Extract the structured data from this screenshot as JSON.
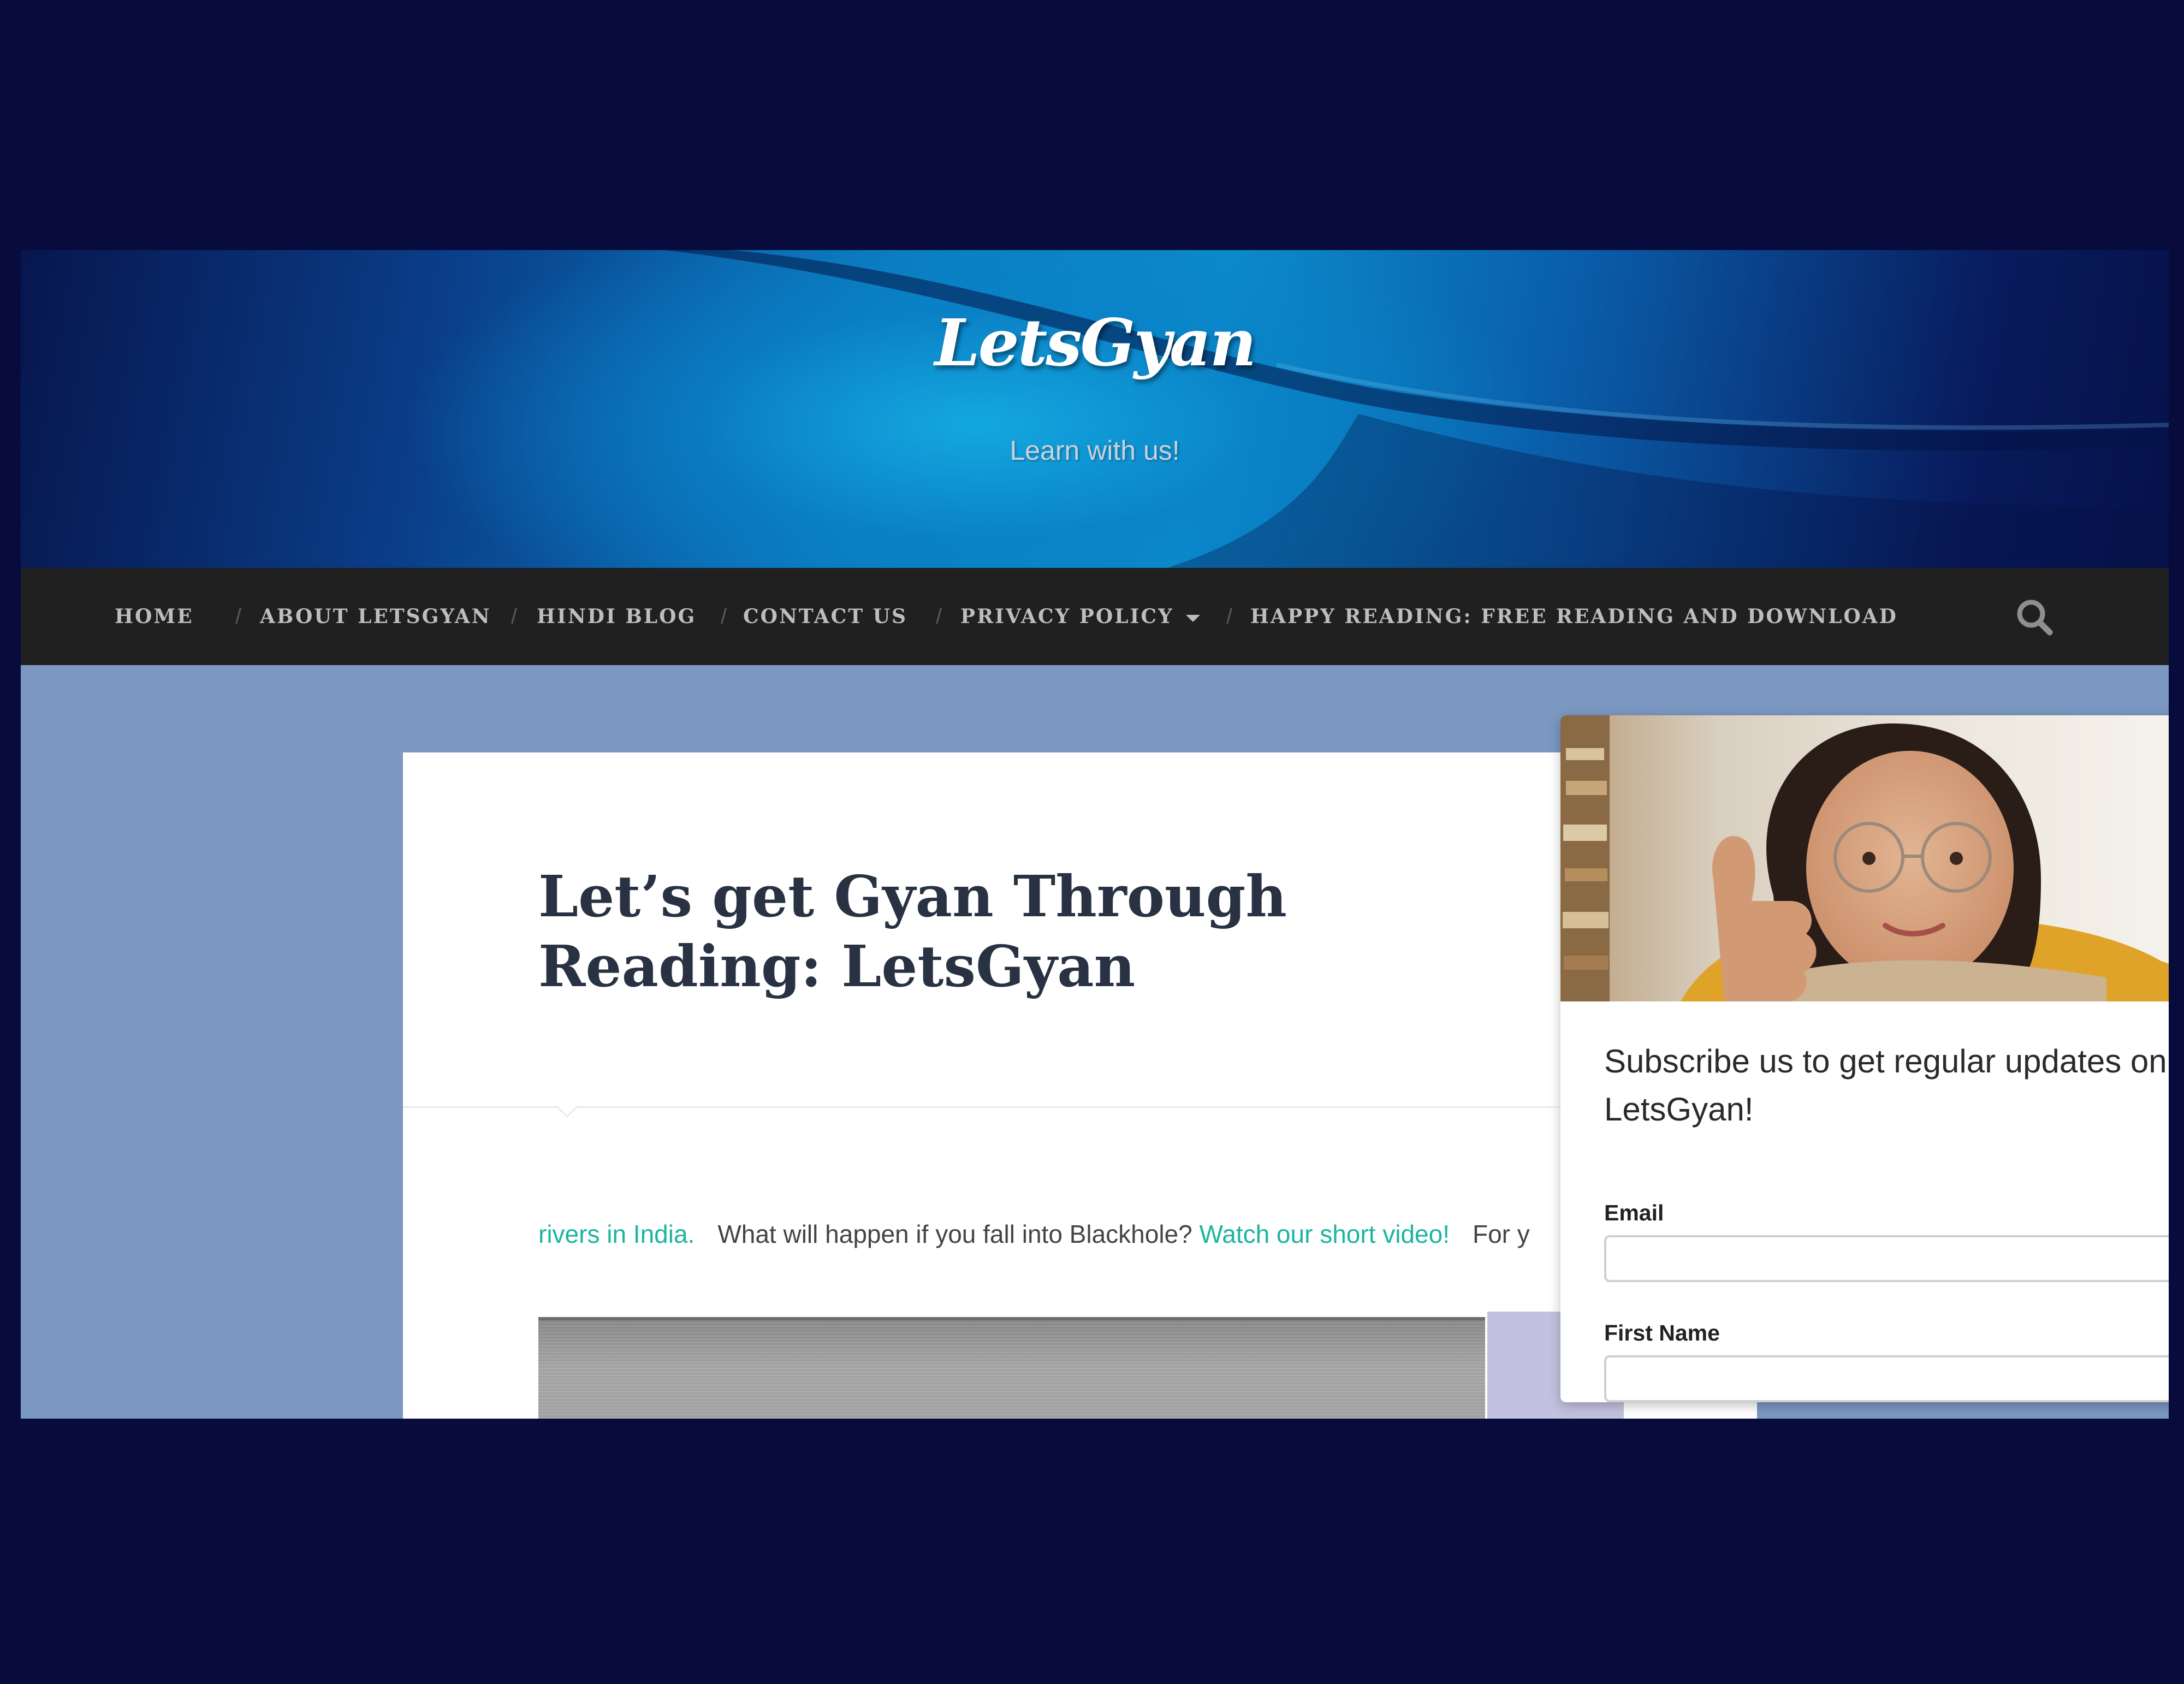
{
  "site": {
    "title": "LetsGyan",
    "tagline": "Learn with us!"
  },
  "nav": {
    "items": [
      {
        "label": "HOME"
      },
      {
        "label": "ABOUT LETSGYAN"
      },
      {
        "label": "HINDI BLOG"
      },
      {
        "label": "CONTACT US"
      },
      {
        "label": "PRIVACY POLICY",
        "has_dropdown": true
      },
      {
        "label": "HAPPY READING: FREE READING AND DOWNLOAD"
      }
    ],
    "separator": "/",
    "search_icon": "search-icon"
  },
  "post": {
    "title": "Let’s get Gyan Through Reading: LetsGyan",
    "ticker": [
      {
        "text": "rivers in India.",
        "link": true
      },
      {
        "text": "What will happen if you fall into Blackhole?",
        "link": false
      },
      {
        "text": "Watch our short video!",
        "link": true
      },
      {
        "text": "For y",
        "link": false
      }
    ]
  },
  "popup": {
    "heading": "Subscribe us to get regular updates on LetsGyan!",
    "fields": [
      {
        "label": "Email",
        "value": "",
        "placeholder": ""
      },
      {
        "label": "First Name",
        "value": "",
        "placeholder": ""
      }
    ]
  },
  "colors": {
    "outer_background": "#080c3d",
    "page_background": "#7b98c2",
    "nav_background": "#202020",
    "nav_text": "#bdbdbd",
    "link": "#1bb5a2",
    "title_text": "#283243"
  }
}
